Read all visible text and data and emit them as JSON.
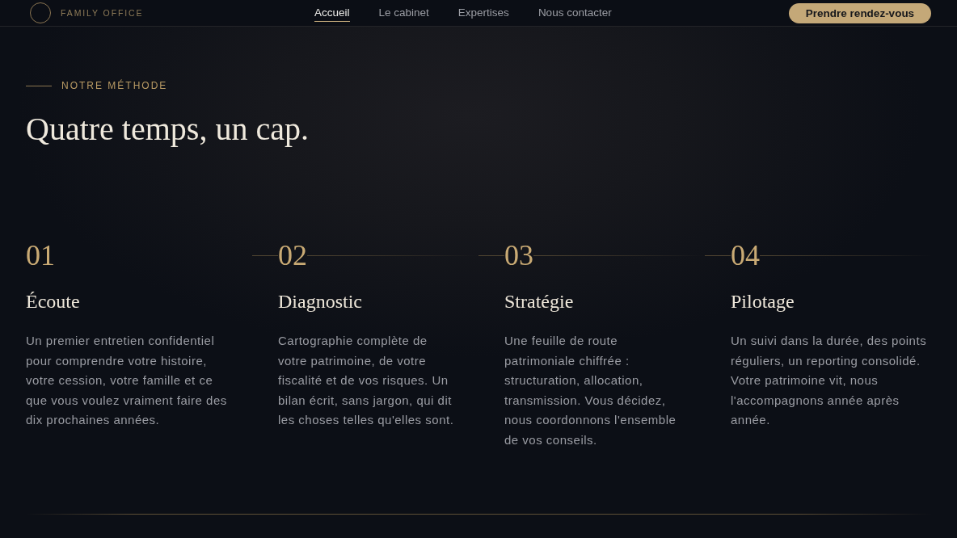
{
  "header": {
    "tagline": "FAMILY OFFICE",
    "nav": [
      {
        "label": "Accueil",
        "selected": true
      },
      {
        "label": "Le cabinet",
        "selected": false
      },
      {
        "label": "Expertises",
        "selected": false
      },
      {
        "label": "Nous contacter",
        "selected": false
      }
    ],
    "cta": "Prendre rendez-vous"
  },
  "section": {
    "eyebrow": "NOTRE MÉTHODE",
    "title": "Quatre temps, un cap.",
    "steps": [
      {
        "number": "01",
        "title": "Écoute",
        "text": "Un premier entretien confidentiel pour comprendre votre histoire, votre cession, votre famille et ce que vous voulez vraiment faire des dix prochaines années."
      },
      {
        "number": "02",
        "title": "Diagnostic",
        "text": "Cartographie complète de votre patrimoine, de votre fiscalité et de vos risques. Un bilan écrit, sans jargon, qui dit les choses telles qu'elles sont."
      },
      {
        "number": "03",
        "title": "Stratégie",
        "text": "Une feuille de route patrimoniale chiffrée : structuration, allocation, transmission. Vous décidez, nous coordonnons l'ensemble de vos conseils."
      },
      {
        "number": "04",
        "title": "Pilotage",
        "text": "Un suivi dans la durée, des points réguliers, un reporting consolidé. Votre patrimoine vit, nous l'accompagnons année après année."
      }
    ]
  }
}
